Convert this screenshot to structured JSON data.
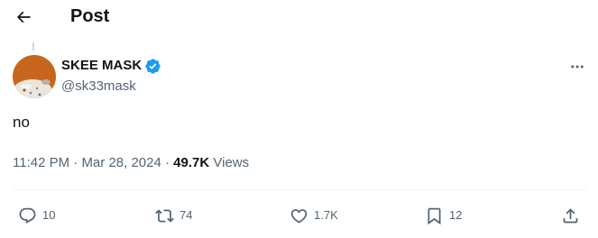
{
  "header": {
    "title": "Post",
    "back_icon": "arrow-left-icon"
  },
  "author": {
    "display_name": "SKEE MASK",
    "handle": "@sk33mask",
    "verified": true,
    "verified_color": "#1d9bf0",
    "avatar_background": "#c8661f"
  },
  "post": {
    "text": "no",
    "time": "11:42 PM",
    "separator": "·",
    "date": "Mar 28, 2024",
    "views_count": "49.7K",
    "views_label": "Views"
  },
  "actions": {
    "replies": {
      "icon": "reply-icon",
      "count": "10"
    },
    "reposts": {
      "icon": "repost-icon",
      "count": "74"
    },
    "likes": {
      "icon": "heart-icon",
      "count": "1.7K"
    },
    "bookmarks": {
      "icon": "bookmark-icon",
      "count": "12"
    },
    "share": {
      "icon": "share-icon"
    }
  },
  "colors": {
    "text_primary": "#0f1419",
    "text_secondary": "#536471",
    "divider": "#eff3f4"
  }
}
